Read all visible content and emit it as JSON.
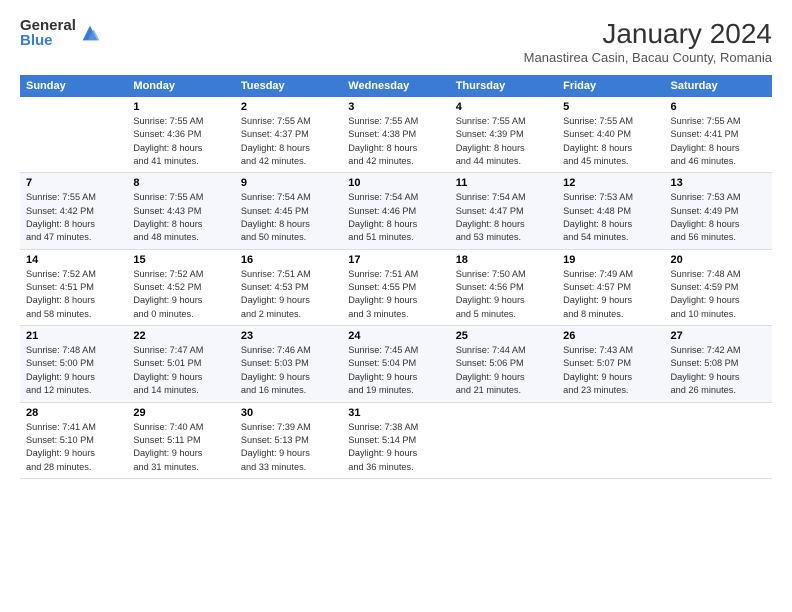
{
  "logo": {
    "general": "General",
    "blue": "Blue"
  },
  "title": "January 2024",
  "subtitle": "Manastirea Casin, Bacau County, Romania",
  "headers": [
    "Sunday",
    "Monday",
    "Tuesday",
    "Wednesday",
    "Thursday",
    "Friday",
    "Saturday"
  ],
  "weeks": [
    [
      {
        "day": "",
        "info": ""
      },
      {
        "day": "1",
        "info": "Sunrise: 7:55 AM\nSunset: 4:36 PM\nDaylight: 8 hours\nand 41 minutes."
      },
      {
        "day": "2",
        "info": "Sunrise: 7:55 AM\nSunset: 4:37 PM\nDaylight: 8 hours\nand 42 minutes."
      },
      {
        "day": "3",
        "info": "Sunrise: 7:55 AM\nSunset: 4:38 PM\nDaylight: 8 hours\nand 42 minutes."
      },
      {
        "day": "4",
        "info": "Sunrise: 7:55 AM\nSunset: 4:39 PM\nDaylight: 8 hours\nand 44 minutes."
      },
      {
        "day": "5",
        "info": "Sunrise: 7:55 AM\nSunset: 4:40 PM\nDaylight: 8 hours\nand 45 minutes."
      },
      {
        "day": "6",
        "info": "Sunrise: 7:55 AM\nSunset: 4:41 PM\nDaylight: 8 hours\nand 46 minutes."
      }
    ],
    [
      {
        "day": "7",
        "info": "Sunrise: 7:55 AM\nSunset: 4:42 PM\nDaylight: 8 hours\nand 47 minutes."
      },
      {
        "day": "8",
        "info": "Sunrise: 7:55 AM\nSunset: 4:43 PM\nDaylight: 8 hours\nand 48 minutes."
      },
      {
        "day": "9",
        "info": "Sunrise: 7:54 AM\nSunset: 4:45 PM\nDaylight: 8 hours\nand 50 minutes."
      },
      {
        "day": "10",
        "info": "Sunrise: 7:54 AM\nSunset: 4:46 PM\nDaylight: 8 hours\nand 51 minutes."
      },
      {
        "day": "11",
        "info": "Sunrise: 7:54 AM\nSunset: 4:47 PM\nDaylight: 8 hours\nand 53 minutes."
      },
      {
        "day": "12",
        "info": "Sunrise: 7:53 AM\nSunset: 4:48 PM\nDaylight: 8 hours\nand 54 minutes."
      },
      {
        "day": "13",
        "info": "Sunrise: 7:53 AM\nSunset: 4:49 PM\nDaylight: 8 hours\nand 56 minutes."
      }
    ],
    [
      {
        "day": "14",
        "info": "Sunrise: 7:52 AM\nSunset: 4:51 PM\nDaylight: 8 hours\nand 58 minutes."
      },
      {
        "day": "15",
        "info": "Sunrise: 7:52 AM\nSunset: 4:52 PM\nDaylight: 9 hours\nand 0 minutes."
      },
      {
        "day": "16",
        "info": "Sunrise: 7:51 AM\nSunset: 4:53 PM\nDaylight: 9 hours\nand 2 minutes."
      },
      {
        "day": "17",
        "info": "Sunrise: 7:51 AM\nSunset: 4:55 PM\nDaylight: 9 hours\nand 3 minutes."
      },
      {
        "day": "18",
        "info": "Sunrise: 7:50 AM\nSunset: 4:56 PM\nDaylight: 9 hours\nand 5 minutes."
      },
      {
        "day": "19",
        "info": "Sunrise: 7:49 AM\nSunset: 4:57 PM\nDaylight: 9 hours\nand 8 minutes."
      },
      {
        "day": "20",
        "info": "Sunrise: 7:48 AM\nSunset: 4:59 PM\nDaylight: 9 hours\nand 10 minutes."
      }
    ],
    [
      {
        "day": "21",
        "info": "Sunrise: 7:48 AM\nSunset: 5:00 PM\nDaylight: 9 hours\nand 12 minutes."
      },
      {
        "day": "22",
        "info": "Sunrise: 7:47 AM\nSunset: 5:01 PM\nDaylight: 9 hours\nand 14 minutes."
      },
      {
        "day": "23",
        "info": "Sunrise: 7:46 AM\nSunset: 5:03 PM\nDaylight: 9 hours\nand 16 minutes."
      },
      {
        "day": "24",
        "info": "Sunrise: 7:45 AM\nSunset: 5:04 PM\nDaylight: 9 hours\nand 19 minutes."
      },
      {
        "day": "25",
        "info": "Sunrise: 7:44 AM\nSunset: 5:06 PM\nDaylight: 9 hours\nand 21 minutes."
      },
      {
        "day": "26",
        "info": "Sunrise: 7:43 AM\nSunset: 5:07 PM\nDaylight: 9 hours\nand 23 minutes."
      },
      {
        "day": "27",
        "info": "Sunrise: 7:42 AM\nSunset: 5:08 PM\nDaylight: 9 hours\nand 26 minutes."
      }
    ],
    [
      {
        "day": "28",
        "info": "Sunrise: 7:41 AM\nSunset: 5:10 PM\nDaylight: 9 hours\nand 28 minutes."
      },
      {
        "day": "29",
        "info": "Sunrise: 7:40 AM\nSunset: 5:11 PM\nDaylight: 9 hours\nand 31 minutes."
      },
      {
        "day": "30",
        "info": "Sunrise: 7:39 AM\nSunset: 5:13 PM\nDaylight: 9 hours\nand 33 minutes."
      },
      {
        "day": "31",
        "info": "Sunrise: 7:38 AM\nSunset: 5:14 PM\nDaylight: 9 hours\nand 36 minutes."
      },
      {
        "day": "",
        "info": ""
      },
      {
        "day": "",
        "info": ""
      },
      {
        "day": "",
        "info": ""
      }
    ]
  ]
}
